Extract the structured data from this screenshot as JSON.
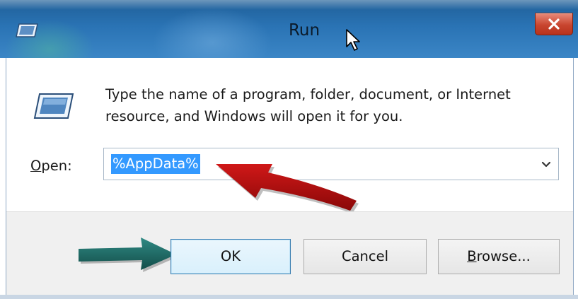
{
  "window": {
    "title": "Run",
    "close_label": "x"
  },
  "dialog": {
    "description_line1": "Type the name of a program, folder, document, or Internet",
    "description_line2": "resource, and Windows will open it for you.",
    "open_label_accel": "O",
    "open_label_rest": "pen:",
    "open_value": "%AppData%"
  },
  "buttons": {
    "ok_label": "OK",
    "cancel_label": "Cancel",
    "browse_accel": "B",
    "browse_rest": "rowse..."
  },
  "icons": {
    "title": "run-app-icon",
    "main": "run-app-icon",
    "close": "close-icon",
    "dropdown": "chevron-down-icon",
    "cursor": "mouse-pointer-icon"
  },
  "colors": {
    "selection": "#3399ff",
    "close_button": "#c8452f",
    "annotation_red": "#b01010",
    "annotation_teal": "#1f6f6a"
  }
}
